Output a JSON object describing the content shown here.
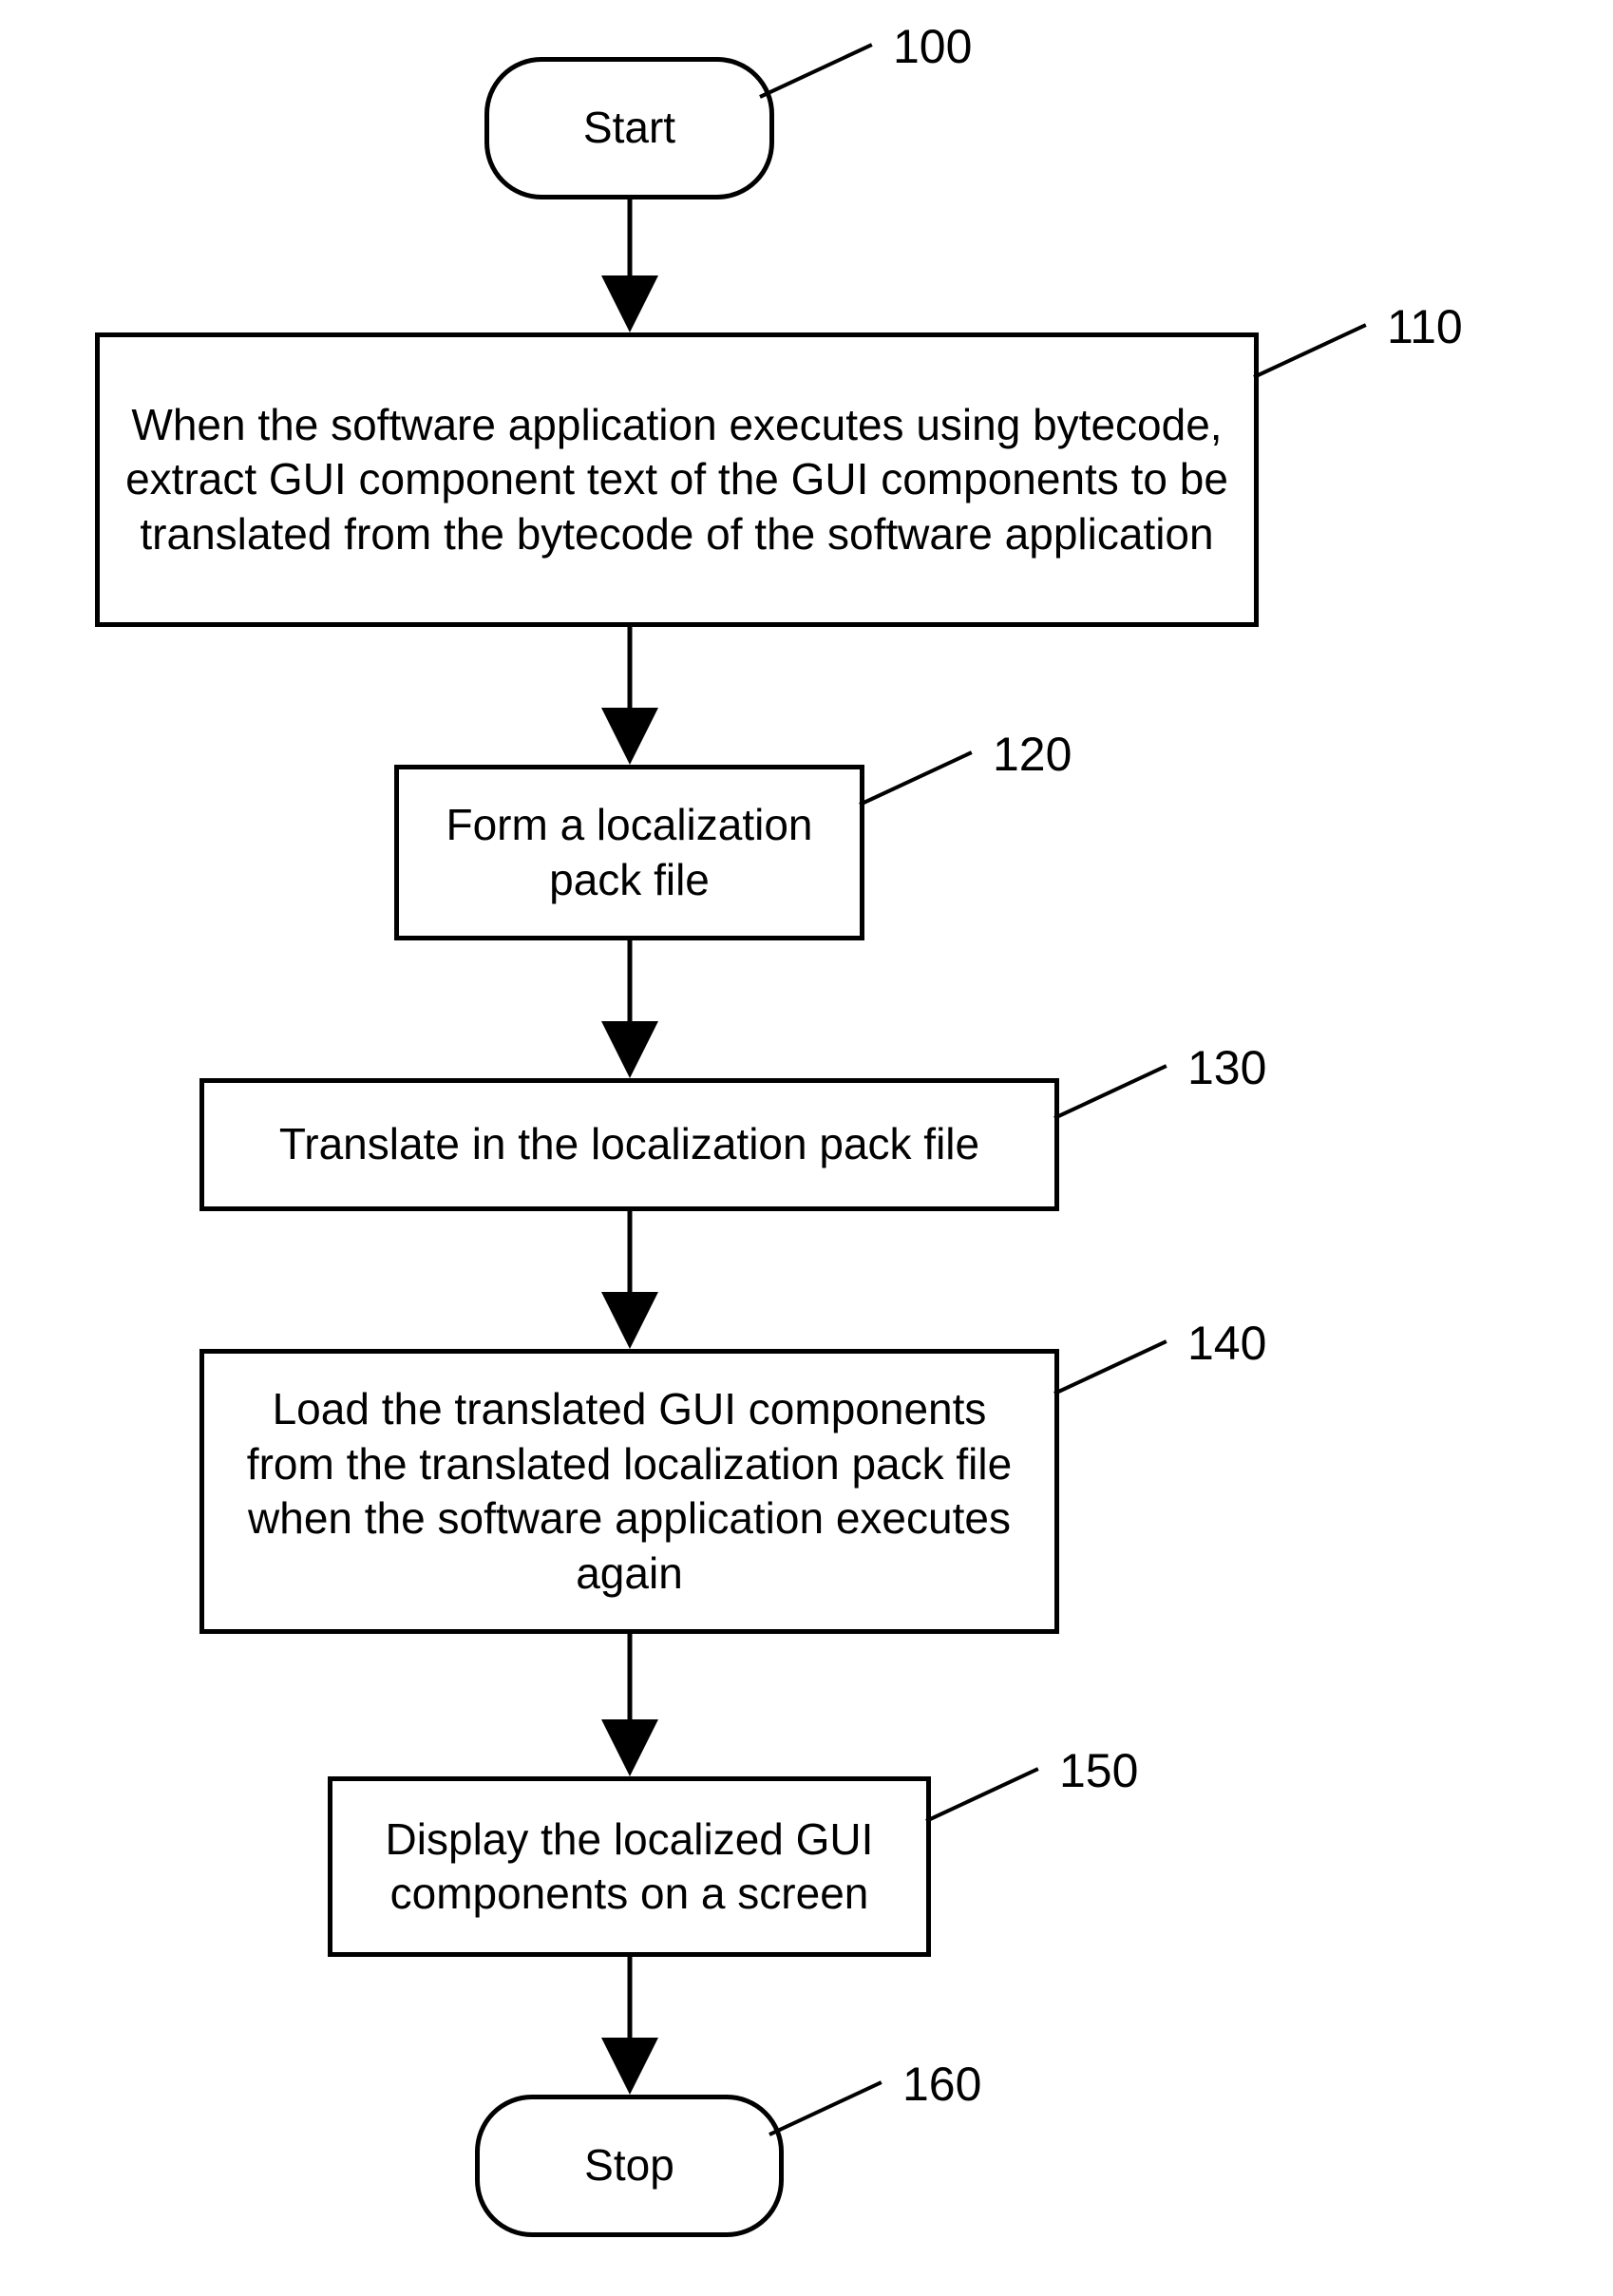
{
  "flow": {
    "steps": [
      {
        "ref": "100",
        "text": "Start"
      },
      {
        "ref": "110",
        "text": "When the software application executes using bytecode, extract GUI component text of the GUI components to be translated from the bytecode of the software application"
      },
      {
        "ref": "120",
        "text": "Form a localization pack file"
      },
      {
        "ref": "130",
        "text": "Translate in the localization pack file"
      },
      {
        "ref": "140",
        "text": "Load the translated GUI components from the translated localization pack file when the software application executes again"
      },
      {
        "ref": "150",
        "text": "Display the localized GUI components on a screen"
      },
      {
        "ref": "160",
        "text": "Stop"
      }
    ]
  }
}
